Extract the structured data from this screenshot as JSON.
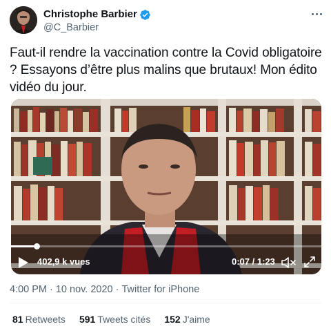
{
  "author": {
    "name": "Christophe Barbier",
    "handle": "@C_Barbier",
    "verified": true
  },
  "tweet": {
    "text": "Faut-il rendre la vaccination contre la Covid obligatoire ? Essayons d’être plus malins que brutaux! Mon édito vidéo du jour."
  },
  "video": {
    "views": "402,9 k vues",
    "time": "0:07 / 1:23",
    "progress": 0.084
  },
  "meta": {
    "time": "4:00 PM",
    "date": "10 nov. 2020",
    "source": "Twitter for iPhone",
    "separator": "·"
  },
  "stats": {
    "retweets_count": "81",
    "retweets_label": "Retweets",
    "quotes_count": "591",
    "quotes_label": "Tweets cités",
    "likes_count": "152",
    "likes_label": "J'aime"
  },
  "colors": {
    "text": "#0f1419",
    "secondary": "#536471",
    "verified": "#1d9bf0"
  }
}
